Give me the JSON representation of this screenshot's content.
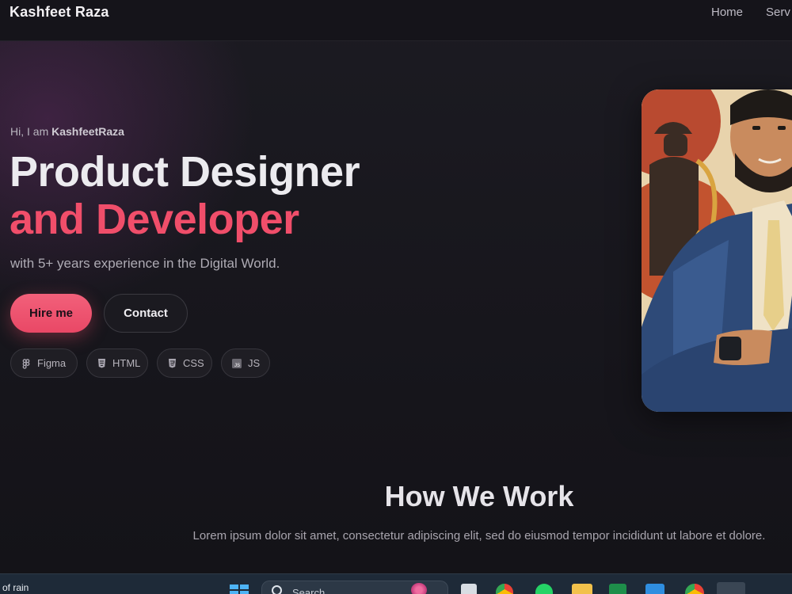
{
  "nav": {
    "brand": "Kashfeet Raza",
    "links": [
      "Home",
      "Serv"
    ]
  },
  "hero": {
    "greeting_prefix": "Hi, I am ",
    "greeting_name": "KashfeetRaza",
    "headline_line1": "Product Designer",
    "headline_line2": "and Developer",
    "tagline": "with 5+ years experience in the Digital World.",
    "hire_button": "Hire me",
    "contact_button": "Contact",
    "skills": [
      {
        "label": "Figma",
        "icon": "figma-icon"
      },
      {
        "label": "HTML",
        "icon": "html5-icon"
      },
      {
        "label": "CSS",
        "icon": "css3-icon"
      },
      {
        "label": "JS",
        "icon": "js-icon"
      }
    ],
    "accent_color": "#f04e6a"
  },
  "how_we_work": {
    "title": "How We Work",
    "text": "Lorem ipsum dolor sit amet, consectetur adipiscing elit, sed do eiusmod tempor incididunt ut labore et dolore."
  },
  "taskbar": {
    "weather_text": "of rain",
    "search_placeholder": "Search",
    "apps": [
      "windows-start-icon",
      "task-view-icon",
      "chrome-icon",
      "whatsapp-icon",
      "file-explorer-icon",
      "sheets-icon",
      "vscode-icon",
      "chrome-profile-icon",
      "app-icon"
    ]
  }
}
